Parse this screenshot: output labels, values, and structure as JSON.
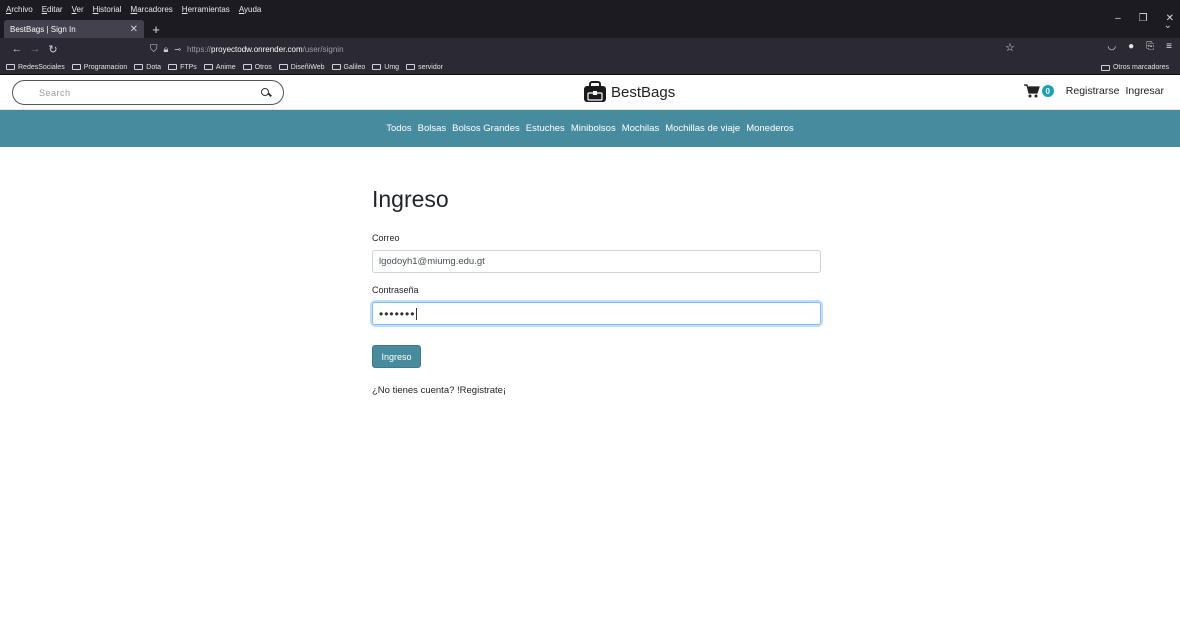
{
  "browser": {
    "menu": [
      "Archivo",
      "Editar",
      "Ver",
      "Historial",
      "Marcadores",
      "Herramientas",
      "Ayuda"
    ],
    "tab_title": "BestBags | Sign In",
    "url": {
      "scheme": "https://",
      "host": "proyectodw.onrender.com",
      "path": "/user/signin"
    },
    "bookmarks": [
      "RedesSociales",
      "Programacion",
      "Dota",
      "FTPs",
      "Anime",
      "Otros",
      "DiseñiWeb",
      "Galileo",
      "Umg",
      "servidor"
    ],
    "other_bookmarks": "Otros marcadores"
  },
  "header": {
    "search_placeholder": "Search",
    "brand_name": "BestBags",
    "cart_count": "0",
    "register_label": "Registrarse",
    "login_label": "Ingresar"
  },
  "categories": [
    "Todos",
    "Bolsas",
    "Bolsos Grandes",
    "Estuches",
    "Minibolsos",
    "Mochilas",
    "Mochillas de viaje",
    "Monederos"
  ],
  "form": {
    "title": "Ingreso",
    "email_label": "Correo",
    "email_value": "lgodoyh1@miumg.edu.gt",
    "password_label": "Contraseña",
    "password_value": "•••••••",
    "submit_label": "Ingreso",
    "signup_text": "¿No tienes cuenta? !Registrate¡"
  },
  "colors": {
    "accent": "#478b9e",
    "badge": "#17a2b8"
  }
}
